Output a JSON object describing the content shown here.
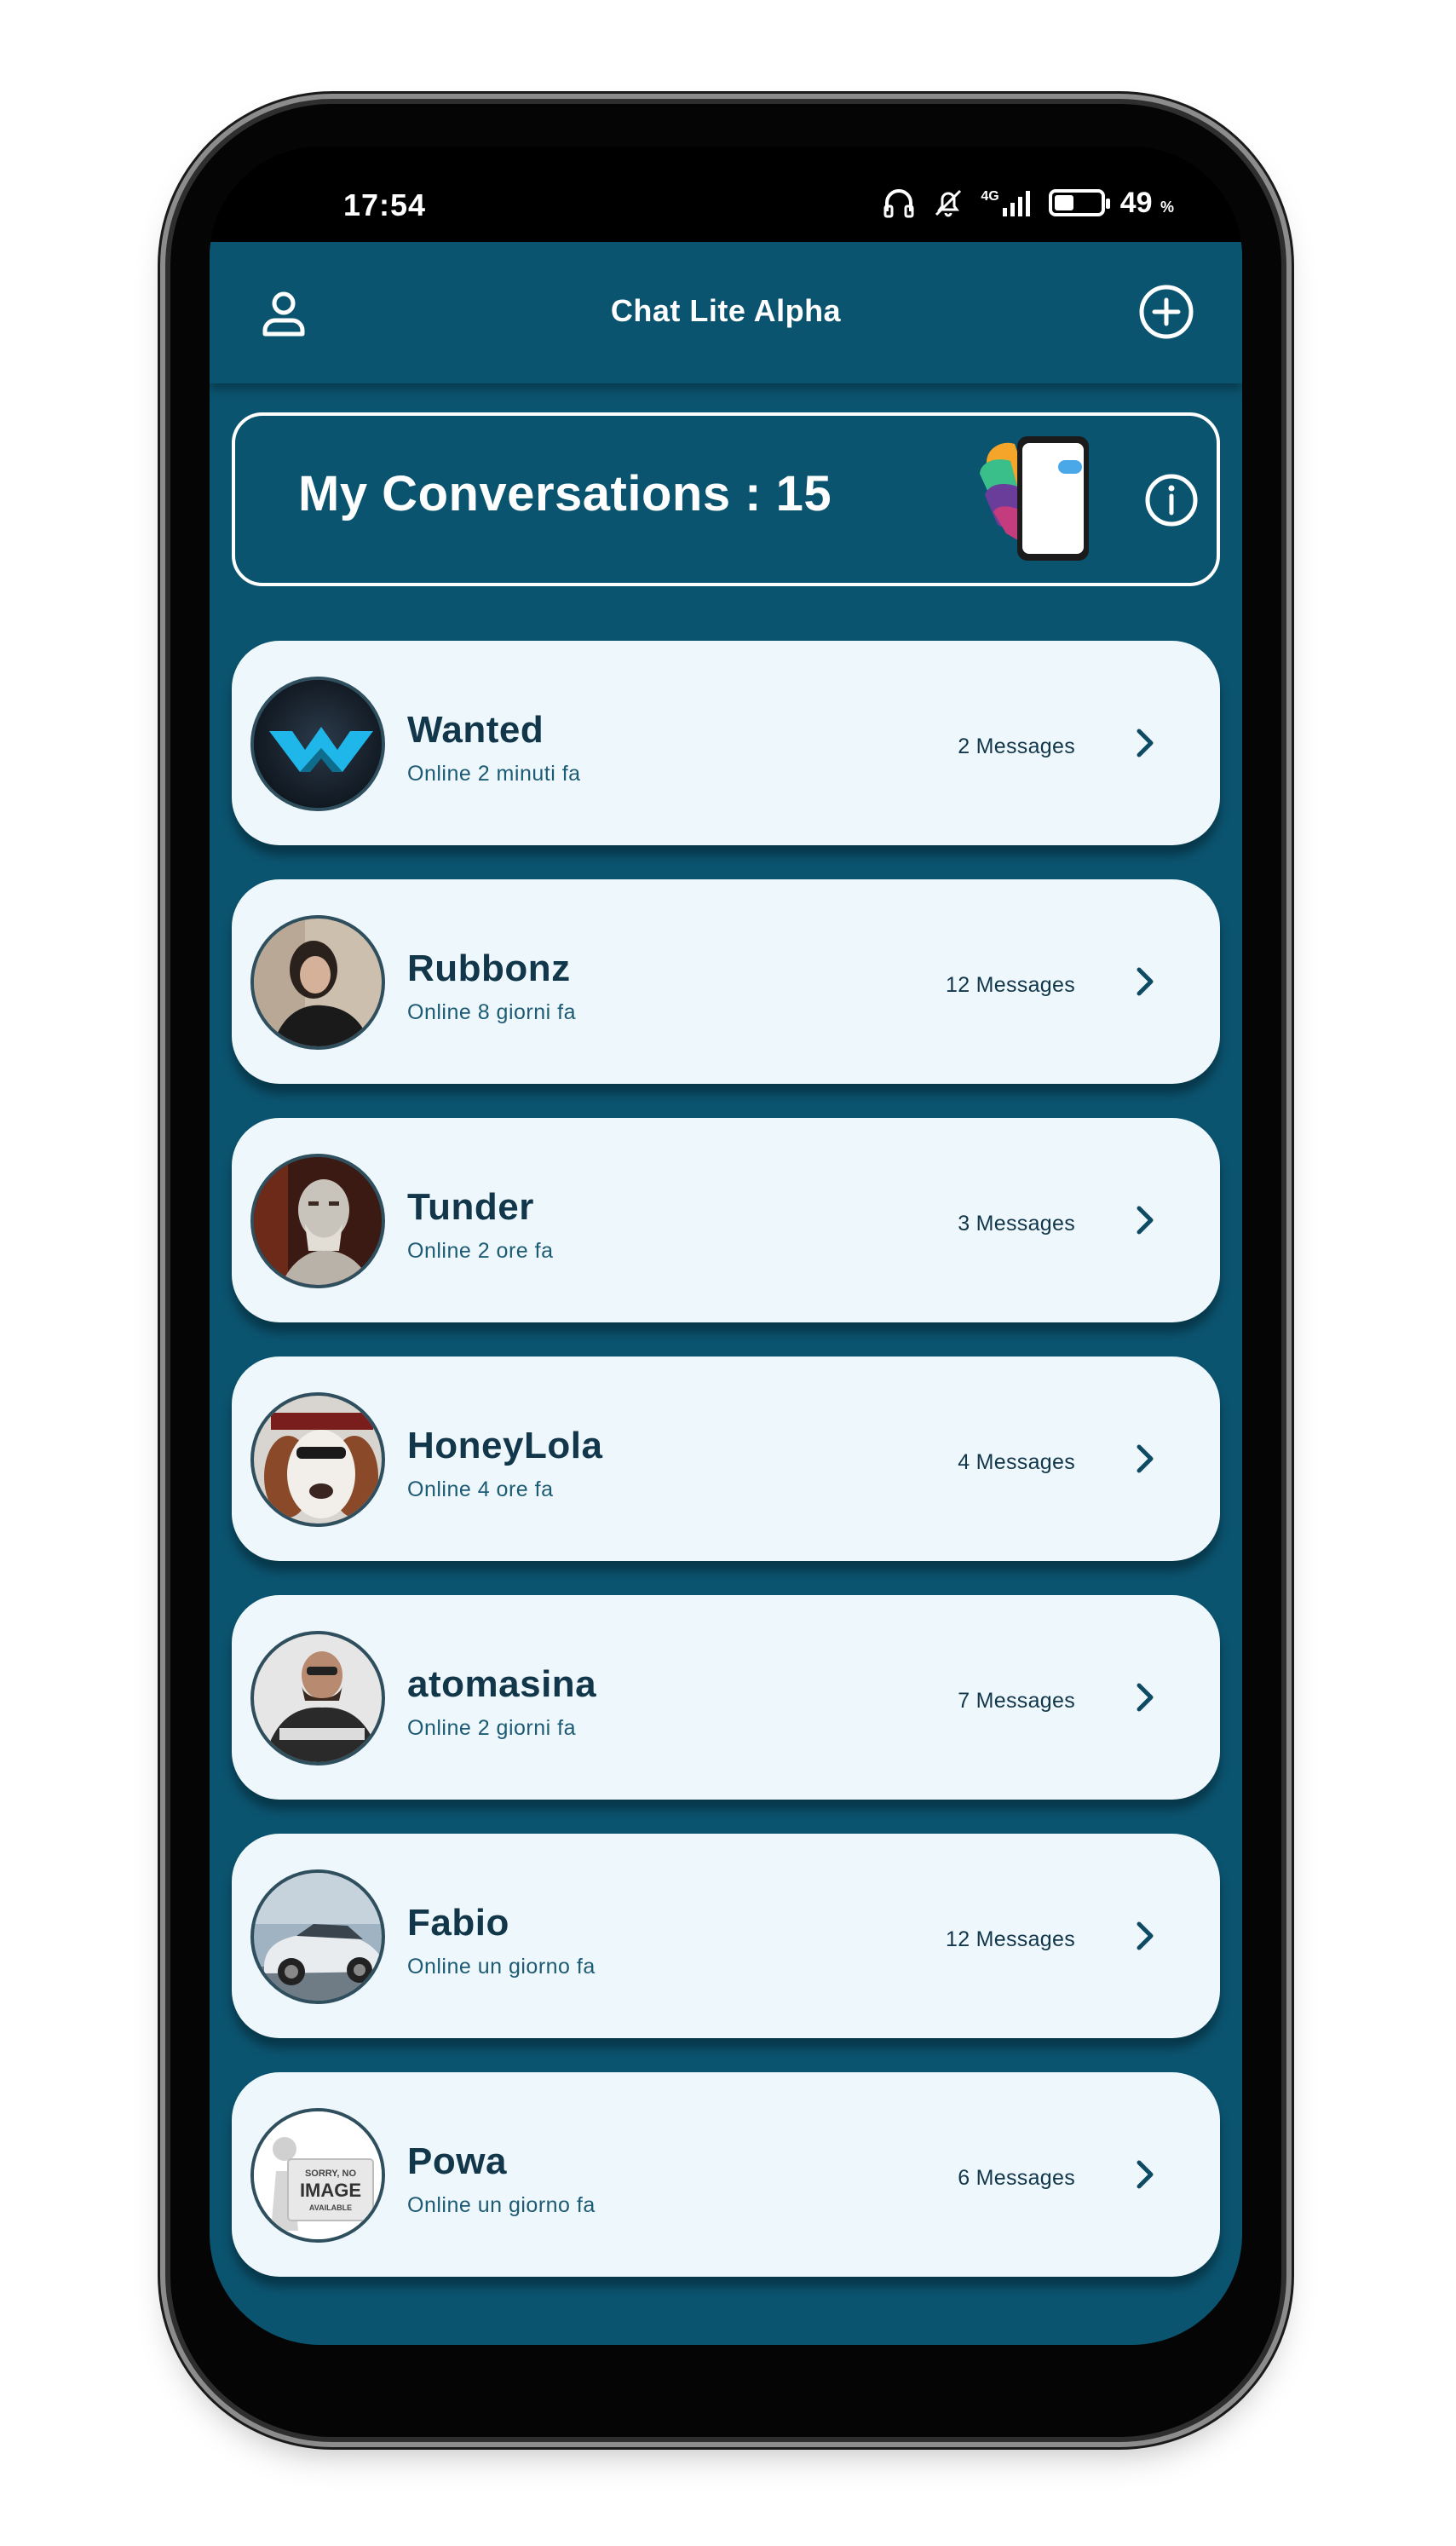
{
  "status_bar": {
    "time": "17:54",
    "network": "4G",
    "battery_percent": "49",
    "battery_unit": "%",
    "battery_level": 0.49
  },
  "app_bar": {
    "title": "Chat Lite Alpha",
    "left_icon": "person-icon",
    "right_icon": "add-circle-icon"
  },
  "summary": {
    "title": "My Conversations : 15",
    "info_icon": "info-icon"
  },
  "conversations": [
    {
      "name": "Wanted",
      "status": "Online 2 minuti fa",
      "messages": "2 Messages",
      "avatar": "logo-w"
    },
    {
      "name": "Rubbonz",
      "status": "Online 8 giorni fa",
      "messages": "12 Messages",
      "avatar": "person-photo"
    },
    {
      "name": "Tunder",
      "status": "Online 2 ore fa",
      "messages": "3 Messages",
      "avatar": "warrior-photo"
    },
    {
      "name": "HoneyLola",
      "status": "Online 4 ore fa",
      "messages": "4 Messages",
      "avatar": "dog-photo"
    },
    {
      "name": "atomasina",
      "status": "Online 2 giorni fa",
      "messages": "7 Messages",
      "avatar": "person-hoodie-photo"
    },
    {
      "name": "Fabio",
      "status": "Online un giorno fa",
      "messages": "12 Messages",
      "avatar": "car-photo"
    },
    {
      "name": "Powa",
      "status": "Online un giorno fa",
      "messages": "6 Messages",
      "avatar": "no-image-placeholder",
      "avatar_text": [
        "SORRY, NO",
        "IMAGE",
        "AVAILABLE"
      ]
    }
  ],
  "colors": {
    "primary": "#0b5470",
    "card": "#eef8fc",
    "text_dark": "#12364a"
  }
}
